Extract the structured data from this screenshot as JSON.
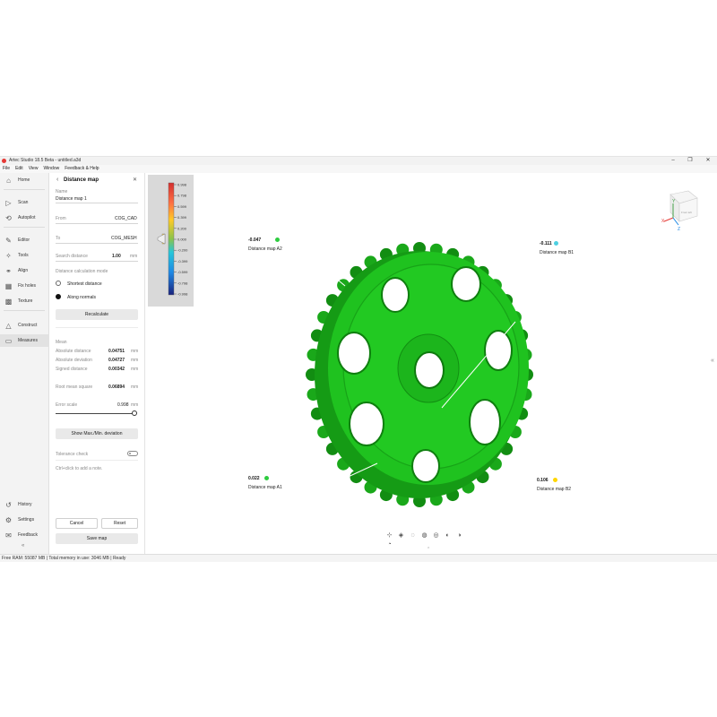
{
  "window": {
    "title": "Artec Studio 18.5 Beta - untitled.a3d",
    "minimize": "–",
    "maximize": "❐",
    "close": "✕"
  },
  "menu": [
    "File",
    "Edit",
    "View",
    "Window",
    "Feedback & Help"
  ],
  "nav": {
    "top": [
      {
        "label": "Home",
        "icon": "home-icon",
        "glyph": "⌂"
      },
      {
        "label": "Scan",
        "icon": "play-icon",
        "glyph": "▷"
      },
      {
        "label": "Autopilot",
        "icon": "autopilot-icon",
        "glyph": "⟲"
      },
      {
        "label": "Editor",
        "icon": "pencil-icon",
        "glyph": "✎"
      },
      {
        "label": "Tools",
        "icon": "wand-icon",
        "glyph": "✧"
      },
      {
        "label": "Align",
        "icon": "align-icon",
        "glyph": "⚭"
      },
      {
        "label": "Fix holes",
        "icon": "fix-holes-icon",
        "glyph": "▦"
      },
      {
        "label": "Texture",
        "icon": "texture-icon",
        "glyph": "▩"
      },
      {
        "label": "Construct",
        "icon": "construct-icon",
        "glyph": "△"
      },
      {
        "label": "Measures",
        "icon": "ruler-icon",
        "glyph": "▭"
      }
    ],
    "bottom": [
      {
        "label": "History",
        "icon": "history-icon",
        "glyph": "↺"
      },
      {
        "label": "Settings",
        "icon": "gear-icon",
        "glyph": "⚙"
      },
      {
        "label": "Feedback",
        "icon": "feedback-icon",
        "glyph": "✉"
      }
    ],
    "collapse": "«"
  },
  "panel": {
    "title": "Distance map",
    "back": "‹",
    "close": "✕",
    "name_label": "Name",
    "name_value": "Distance map 1",
    "from_label": "From",
    "from_value": "COG_CAD",
    "to_label": "To",
    "to_value": "COG_MESH",
    "search_label": "Search distance",
    "search_value": "1.00",
    "search_unit": "mm",
    "calc_mode_label": "Distance calculation mode",
    "mode_shortest": "Shortest distance",
    "mode_normals": "Along normals",
    "recalculate": "Recalculate",
    "mean_label": "Mean",
    "abs_dist_label": "Absolute distance",
    "abs_dist_value": "0.04751",
    "abs_dev_label": "Absolute deviation",
    "abs_dev_value": "0.04727",
    "signed_label": "Signed distance",
    "signed_value": "0.00342",
    "rms_label": "Root mean square",
    "rms_value": "0.06894",
    "unit": "mm",
    "error_scale_label": "Error scale",
    "error_scale_value": "0.998",
    "show_maxmin": "Show Max./Min. deviation",
    "tolerance_label": "Tolerance check",
    "note_hint": "Ctrl+click to add a note.",
    "cancel": "Cancel",
    "reset": "Reset",
    "save": "Save map"
  },
  "scale": {
    "labels": [
      "0.998",
      "0.798",
      "0.599",
      "0.399",
      "0.200",
      "0.000",
      "-0.200",
      "-0.399",
      "-0.599",
      "-0.798",
      "-0.998"
    ],
    "colors": {
      "top": "#e53935",
      "upper": "#ff9800",
      "mid": "#8bc34a",
      "lower": "#2196f3",
      "bottom": "#1a237e"
    }
  },
  "callouts": [
    {
      "value": "-0.047",
      "name": "Distance map A2",
      "color": "#2ecc40"
    },
    {
      "value": "-0.111",
      "name": "Distance map B1",
      "color": "#4dd0e1"
    },
    {
      "value": "0.022",
      "name": "Distance map A1",
      "color": "#2ecc40"
    },
    {
      "value": "0.106",
      "name": "Distance map B2",
      "color": "#ffd600"
    }
  ],
  "gizmo": {
    "x": "X",
    "y": "Y",
    "z": "Z",
    "view": "Front left"
  },
  "status": "Free RAM: 55087 MB  |  Total memory in use: 3046 MB  |  Ready",
  "colors": {
    "gear_green": "#1fc21f",
    "gear_dark": "#129412"
  }
}
